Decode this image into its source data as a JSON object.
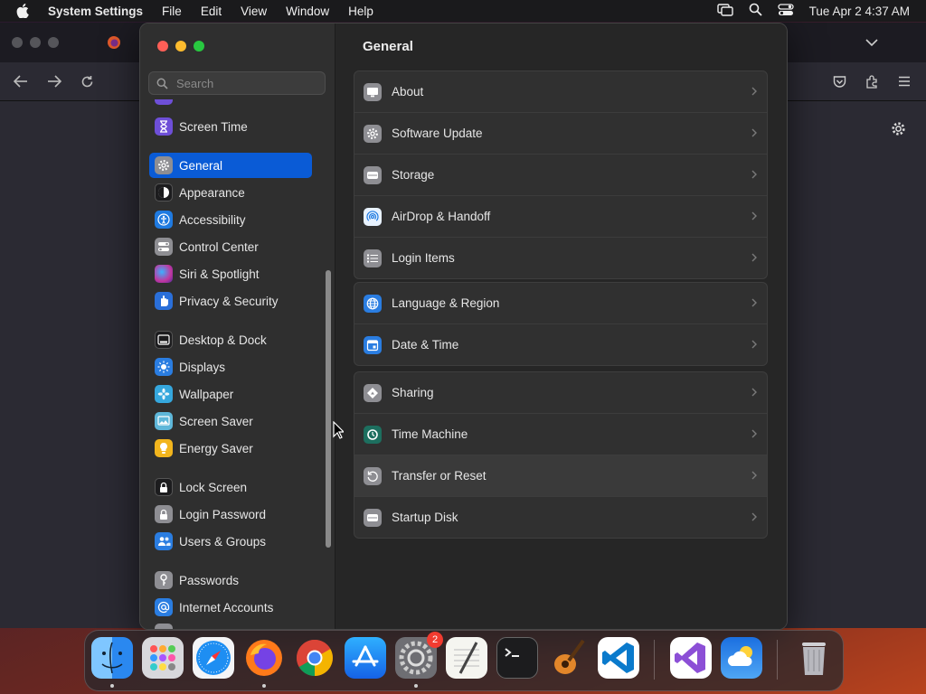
{
  "menubar": {
    "app_name": "System Settings",
    "menus": [
      "File",
      "Edit",
      "View",
      "Window",
      "Help"
    ],
    "clock": "Tue Apr 2  4:37 AM"
  },
  "sidebar": {
    "search_placeholder": "Search",
    "items": [
      {
        "label": "Screen Time",
        "icon": "hourglass-icon",
        "color": "#6e4fd8"
      },
      {
        "label": "General",
        "icon": "gear-icon",
        "color": "#8e8e93",
        "selected": true
      },
      {
        "label": "Appearance",
        "icon": "appearance-icon",
        "color": "#1c1c1e"
      },
      {
        "label": "Accessibility",
        "icon": "accessibility-icon",
        "color": "#1f7ae0"
      },
      {
        "label": "Control Center",
        "icon": "toggles-icon",
        "color": "#8e8e93"
      },
      {
        "label": "Siri & Spotlight",
        "icon": "siri-icon",
        "color": "#c2369e"
      },
      {
        "label": "Privacy & Security",
        "icon": "hand-icon",
        "color": "#2a6fd9"
      },
      {
        "label": "Desktop & Dock",
        "icon": "dock-icon",
        "color": "#1c1c1e"
      },
      {
        "label": "Displays",
        "icon": "sun-icon",
        "color": "#2a7de1"
      },
      {
        "label": "Wallpaper",
        "icon": "flower-icon",
        "color": "#35a7dd"
      },
      {
        "label": "Screen Saver",
        "icon": "screensaver-icon",
        "color": "#5eb7d9"
      },
      {
        "label": "Energy Saver",
        "icon": "bulb-icon",
        "color": "#f2b51d"
      },
      {
        "label": "Lock Screen",
        "icon": "lock-icon",
        "color": "#1c1c1e"
      },
      {
        "label": "Login Password",
        "icon": "padlock-icon",
        "color": "#8e8e93"
      },
      {
        "label": "Users & Groups",
        "icon": "users-icon",
        "color": "#2a7de1"
      },
      {
        "label": "Passwords",
        "icon": "key-icon",
        "color": "#8e8e93"
      },
      {
        "label": "Internet Accounts",
        "icon": "at-icon",
        "color": "#2a7de1"
      }
    ]
  },
  "content": {
    "title": "General",
    "groups": [
      [
        {
          "label": "About",
          "icon": "monitor-icon"
        },
        {
          "label": "Software Update",
          "icon": "gear-badge-icon"
        },
        {
          "label": "Storage",
          "icon": "drive-icon"
        },
        {
          "label": "AirDrop & Handoff",
          "icon": "airdrop-icon"
        },
        {
          "label": "Login Items",
          "icon": "list-icon"
        }
      ],
      [
        {
          "label": "Language & Region",
          "icon": "globe-icon"
        },
        {
          "label": "Date & Time",
          "icon": "calendar-icon"
        }
      ],
      [
        {
          "label": "Sharing",
          "icon": "sharing-icon"
        },
        {
          "label": "Time Machine",
          "icon": "time-machine-icon"
        },
        {
          "label": "Transfer or Reset",
          "icon": "reset-icon"
        },
        {
          "label": "Startup Disk",
          "icon": "disk-icon"
        }
      ]
    ]
  },
  "dock": {
    "apps": [
      "Finder",
      "Launchpad",
      "Safari",
      "Firefox",
      "Chrome",
      "App Store",
      "System Settings",
      "TextEdit",
      "Terminal",
      "GarageBand",
      "Visual Studio Code",
      "Visual Studio",
      "Weather",
      "Trash"
    ],
    "settings_badge": "2"
  }
}
